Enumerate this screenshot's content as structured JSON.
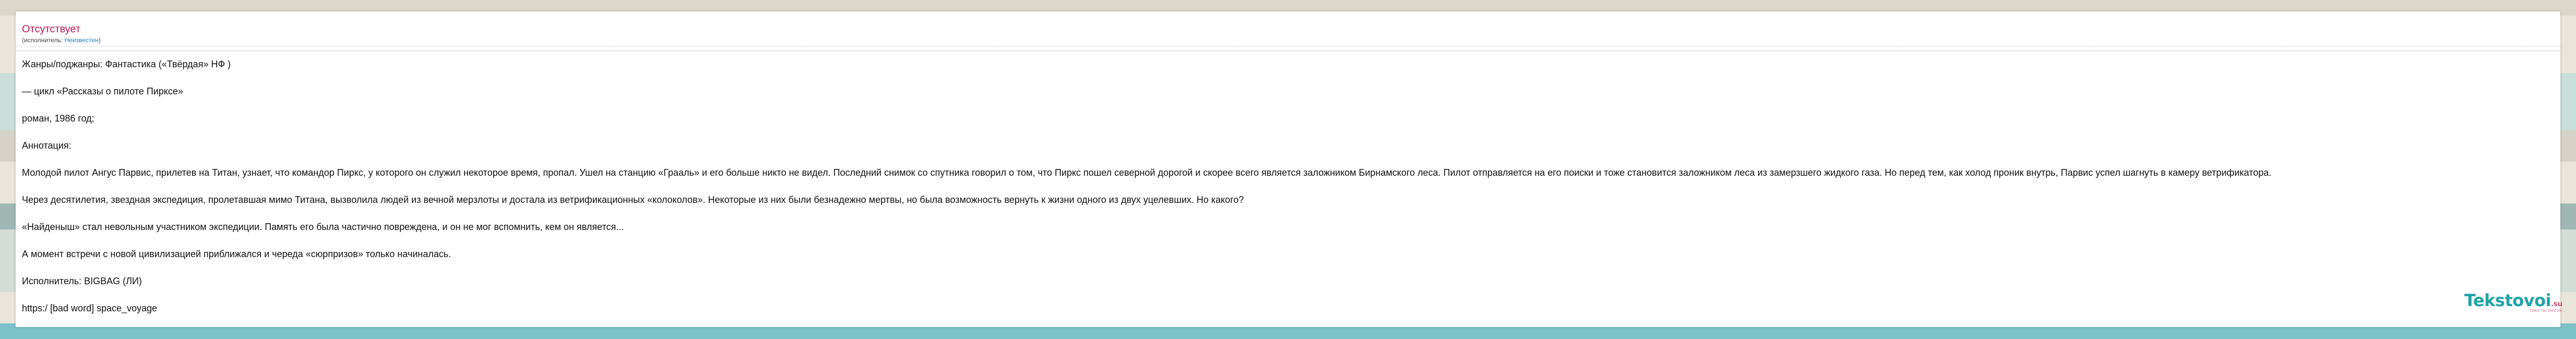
{
  "status_title": "Отсутствует",
  "performer_label": "(исполнитель:",
  "performer_value": "Неизвестен",
  "performer_close": ")",
  "lines": [
    "Жанры/поджанры: Фантастика («Твёрдая» НФ )",
    "— цикл «Рассказы о пилоте Пирксе»",
    "роман, 1986 год;",
    "Аннотация:",
    "Молодой пилот Ангус Парвис, прилетев на Титан, узнает, что командор Пиркс, у которого он служил некоторое время, пропал. Ушел на станцию «Грааль» и его больше никто не видел. Последний снимок со спутника говорил о том, что Пиркс пошел северной дорогой и скорее всего является заложником Бирнамского леса. Пилот отправляется на его поиски и тоже становится заложником леса из замерзшего жидкого газа. Но перед тем, как холод проник внутрь, Парвис успел шагнуть в камеру ветрификатора.",
    "Через десятилетия, звездная экспедиция, пролетавшая мимо Титана, вызволила людей из вечной мерзлоты и достала из ветрификационных «колоколов». Некоторые из них были безнадежно мертвы, но была возможность вернуть к жизни одного из двух уцелевших. Но какого?",
    "«Найденыш» стал невольным участником экспедиции. Память его была частично повреждена, и он не мог вспомнить, кем он является...",
    "А момент встречи с новой цивилизацией приближался и череда «сюрпризов» только начиналась.",
    "Исполнитель: BIGBAG (ЛИ)",
    "https:/ [bad word] space_voyage"
  ],
  "logo": {
    "name": "Tekstovoi",
    "tld": ".su",
    "tagline": "тексты песен"
  }
}
